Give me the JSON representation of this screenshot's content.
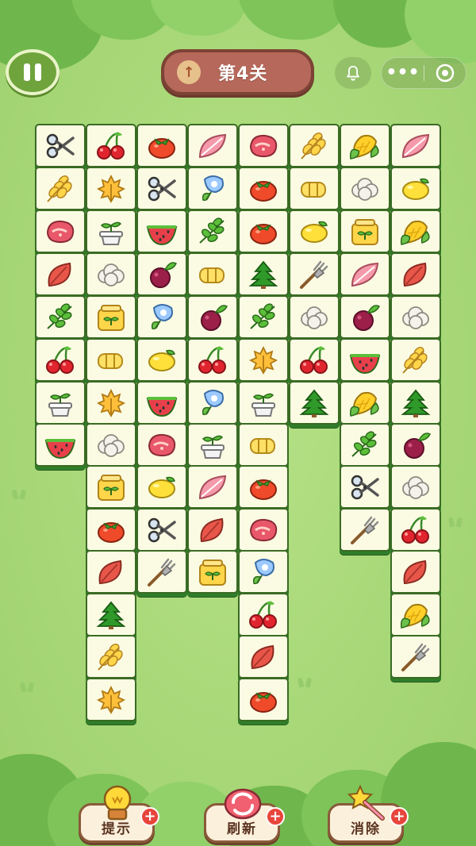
{
  "header": {
    "level_title": "第4关",
    "pause_icon": "pause-icon",
    "level_up_icon": "arrow-up-icon",
    "bell_icon": "bell-icon",
    "more_glyph": "•••",
    "target_icon": "target-icon"
  },
  "colors": {
    "background": "#a9d97a",
    "tile_face": "#fbfbe3",
    "tile_border": "#3a6b24",
    "level_pill": "#b6685a",
    "plus_badge": "#e8453c"
  },
  "board": {
    "tiles": [
      {
        "row": 0,
        "col": 0,
        "item": "scissors"
      },
      {
        "row": 0,
        "col": 1,
        "item": "cherry"
      },
      {
        "row": 0,
        "col": 2,
        "item": "tomato"
      },
      {
        "row": 0,
        "col": 3,
        "item": "pink-leaf"
      },
      {
        "row": 0,
        "col": 4,
        "item": "meat"
      },
      {
        "row": 0,
        "col": 5,
        "item": "wheat"
      },
      {
        "row": 0,
        "col": 6,
        "item": "corn"
      },
      {
        "row": 0,
        "col": 7,
        "item": "pink-leaf"
      },
      {
        "row": 1,
        "col": 0,
        "item": "wheat"
      },
      {
        "row": 1,
        "col": 1,
        "item": "maple-leaf"
      },
      {
        "row": 1,
        "col": 2,
        "item": "scissors"
      },
      {
        "row": 1,
        "col": 3,
        "item": "blue-flower"
      },
      {
        "row": 1,
        "col": 4,
        "item": "tomato"
      },
      {
        "row": 1,
        "col": 5,
        "item": "cheese-roll"
      },
      {
        "row": 1,
        "col": 6,
        "item": "cauliflower"
      },
      {
        "row": 1,
        "col": 7,
        "item": "lemon"
      },
      {
        "row": 2,
        "col": 0,
        "item": "meat"
      },
      {
        "row": 2,
        "col": 1,
        "item": "sprout-pot"
      },
      {
        "row": 2,
        "col": 2,
        "item": "watermelon"
      },
      {
        "row": 2,
        "col": 3,
        "item": "green-leaf"
      },
      {
        "row": 2,
        "col": 4,
        "item": "tomato"
      },
      {
        "row": 2,
        "col": 5,
        "item": "lemon"
      },
      {
        "row": 2,
        "col": 6,
        "item": "seed-bag"
      },
      {
        "row": 2,
        "col": 7,
        "item": "corn"
      },
      {
        "row": 3,
        "col": 0,
        "item": "red-leaf"
      },
      {
        "row": 3,
        "col": 1,
        "item": "cauliflower"
      },
      {
        "row": 3,
        "col": 2,
        "item": "beet"
      },
      {
        "row": 3,
        "col": 3,
        "item": "cheese-roll"
      },
      {
        "row": 3,
        "col": 4,
        "item": "pine-tree"
      },
      {
        "row": 3,
        "col": 5,
        "item": "fork"
      },
      {
        "row": 3,
        "col": 6,
        "item": "pink-leaf"
      },
      {
        "row": 3,
        "col": 7,
        "item": "red-leaf"
      },
      {
        "row": 4,
        "col": 0,
        "item": "green-leaf"
      },
      {
        "row": 4,
        "col": 1,
        "item": "seed-bag"
      },
      {
        "row": 4,
        "col": 2,
        "item": "blue-flower"
      },
      {
        "row": 4,
        "col": 3,
        "item": "beet"
      },
      {
        "row": 4,
        "col": 4,
        "item": "green-leaf"
      },
      {
        "row": 4,
        "col": 5,
        "item": "cauliflower"
      },
      {
        "row": 4,
        "col": 6,
        "item": "beet"
      },
      {
        "row": 4,
        "col": 7,
        "item": "cauliflower"
      },
      {
        "row": 5,
        "col": 0,
        "item": "cherry"
      },
      {
        "row": 5,
        "col": 1,
        "item": "cheese-roll"
      },
      {
        "row": 5,
        "col": 2,
        "item": "lemon"
      },
      {
        "row": 5,
        "col": 3,
        "item": "cherry"
      },
      {
        "row": 5,
        "col": 4,
        "item": "maple-leaf"
      },
      {
        "row": 5,
        "col": 5,
        "item": "cherry"
      },
      {
        "row": 5,
        "col": 6,
        "item": "watermelon"
      },
      {
        "row": 5,
        "col": 7,
        "item": "wheat"
      },
      {
        "row": 6,
        "col": 0,
        "item": "sprout-pot"
      },
      {
        "row": 6,
        "col": 1,
        "item": "maple-leaf"
      },
      {
        "row": 6,
        "col": 2,
        "item": "watermelon"
      },
      {
        "row": 6,
        "col": 3,
        "item": "blue-flower"
      },
      {
        "row": 6,
        "col": 4,
        "item": "sprout-pot"
      },
      {
        "row": 6,
        "col": 5,
        "item": "pine-tree"
      },
      {
        "row": 6,
        "col": 6,
        "item": "corn"
      },
      {
        "row": 6,
        "col": 7,
        "item": "pine-tree"
      },
      {
        "row": 7,
        "col": 0,
        "item": "watermelon"
      },
      {
        "row": 7,
        "col": 1,
        "item": "cauliflower"
      },
      {
        "row": 7,
        "col": 2,
        "item": "meat"
      },
      {
        "row": 7,
        "col": 3,
        "item": "sprout-pot"
      },
      {
        "row": 7,
        "col": 4,
        "item": "cheese-roll"
      },
      {
        "row": 7,
        "col": 6,
        "item": "green-leaf"
      },
      {
        "row": 7,
        "col": 7,
        "item": "beet"
      },
      {
        "row": 8,
        "col": 1,
        "item": "seed-bag"
      },
      {
        "row": 8,
        "col": 2,
        "item": "lemon"
      },
      {
        "row": 8,
        "col": 3,
        "item": "pink-leaf"
      },
      {
        "row": 8,
        "col": 4,
        "item": "tomato"
      },
      {
        "row": 8,
        "col": 6,
        "item": "scissors"
      },
      {
        "row": 8,
        "col": 7,
        "item": "cauliflower"
      },
      {
        "row": 9,
        "col": 1,
        "item": "tomato"
      },
      {
        "row": 9,
        "col": 2,
        "item": "scissors"
      },
      {
        "row": 9,
        "col": 3,
        "item": "red-leaf"
      },
      {
        "row": 9,
        "col": 4,
        "item": "meat"
      },
      {
        "row": 9,
        "col": 6,
        "item": "fork"
      },
      {
        "row": 9,
        "col": 7,
        "item": "cherry"
      },
      {
        "row": 10,
        "col": 1,
        "item": "red-leaf"
      },
      {
        "row": 10,
        "col": 2,
        "item": "fork"
      },
      {
        "row": 10,
        "col": 3,
        "item": "seed-bag"
      },
      {
        "row": 10,
        "col": 4,
        "item": "blue-flower"
      },
      {
        "row": 10,
        "col": 7,
        "item": "red-leaf"
      },
      {
        "row": 11,
        "col": 1,
        "item": "pine-tree"
      },
      {
        "row": 11,
        "col": 4,
        "item": "cherry"
      },
      {
        "row": 11,
        "col": 7,
        "item": "corn"
      },
      {
        "row": 12,
        "col": 1,
        "item": "wheat"
      },
      {
        "row": 12,
        "col": 4,
        "item": "red-leaf"
      },
      {
        "row": 12,
        "col": 7,
        "item": "fork"
      },
      {
        "row": 13,
        "col": 1,
        "item": "maple-leaf"
      },
      {
        "row": 13,
        "col": 4,
        "item": "tomato"
      }
    ]
  },
  "tools": [
    {
      "label": "提示",
      "icon": "lightbulb-icon",
      "badge": "+"
    },
    {
      "label": "刷新",
      "icon": "refresh-icon",
      "badge": "+"
    },
    {
      "label": "消除",
      "icon": "magic-wand-icon",
      "badge": "+"
    }
  ]
}
